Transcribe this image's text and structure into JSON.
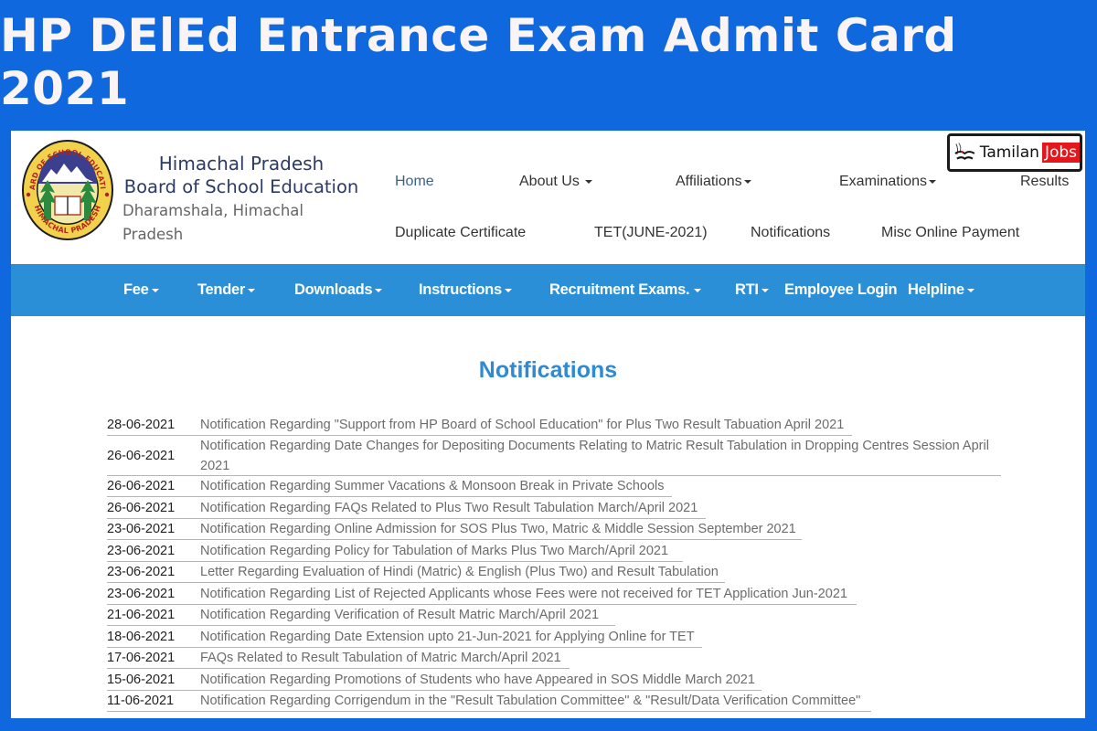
{
  "banner": {
    "title": "HP DElEd Entrance Exam Admit Card 2021"
  },
  "header": {
    "logo": {
      "ring_top": "BOARD OF SCHOOL EDUCATION",
      "ring_bottom": "HIMACHAL PRADESH"
    },
    "org_name_line1": "Himachal Pradesh",
    "org_name_line2": "Board of School Education",
    "org_location": "Dharamshala, Himachal Pradesh"
  },
  "watermark": {
    "text": "Tamilan",
    "highlight": "Jobs"
  },
  "top_nav": [
    {
      "label": "Home",
      "dropdown": false,
      "active": true
    },
    {
      "label": "About Us",
      "dropdown": true
    },
    {
      "label": "Affiliations",
      "dropdown": true
    },
    {
      "label": "Examinations",
      "dropdown": true
    },
    {
      "label": "Results",
      "dropdown": false
    },
    {
      "label": "Duplicate Certificate",
      "dropdown": false
    },
    {
      "label": "TET(JUNE-2021)",
      "dropdown": false
    },
    {
      "label": "Notifications",
      "dropdown": false
    },
    {
      "label": "Misc Online Payment",
      "dropdown": false
    }
  ],
  "main_nav": [
    {
      "label": "Fee",
      "dropdown": true
    },
    {
      "label": "Tender",
      "dropdown": true
    },
    {
      "label": "Downloads",
      "dropdown": true
    },
    {
      "label": "Instructions",
      "dropdown": true
    },
    {
      "label": "Recruitment Exams.",
      "dropdown": true
    },
    {
      "label": "RTI",
      "dropdown": true
    },
    {
      "label": "Employee Login",
      "dropdown": false
    },
    {
      "label": "Helpline",
      "dropdown": true
    }
  ],
  "notifications": {
    "title": "Notifications",
    "items": [
      {
        "date": "28-06-2021",
        "text": "Notification Regarding \"Support from HP Board of School Education\" for Plus Two Result Tabuation April 2021"
      },
      {
        "date": "26-06-2021",
        "text": "Notification Regarding Date Changes for Depositing Documents Relating to Matric Result Tabulation in Dropping Centres Session April 2021"
      },
      {
        "date": "26-06-2021",
        "text": "Notification Regarding Summer Vacations & Monsoon Break in Private Schools"
      },
      {
        "date": "26-06-2021",
        "text": "Notification Regarding FAQs Related to Plus Two Result Tabulation March/April 2021"
      },
      {
        "date": "23-06-2021",
        "text": "Notification Regarding Online Admission for SOS Plus Two, Matric & Middle Session September 2021"
      },
      {
        "date": "23-06-2021",
        "text": "Notification Regarding Policy for Tabulation of Marks Plus Two March/April 2021"
      },
      {
        "date": "23-06-2021",
        "text": "Letter Regarding Evaluation of Hindi (Matric) & English (Plus Two) and Result Tabulation"
      },
      {
        "date": "23-06-2021",
        "text": "Notification Regarding List of Rejected Applicants whose Fees were not received for TET Application Jun-2021"
      },
      {
        "date": "21-06-2021",
        "text": "Notification Regarding Verification of Result Matric March/April 2021"
      },
      {
        "date": "18-06-2021",
        "text": "Notification Regarding Date Extension upto 21-Jun-2021 for Applying Online for TET"
      },
      {
        "date": "17-06-2021",
        "text": "FAQs Related to Result Tabulation of Matric March/April 2021"
      },
      {
        "date": "15-06-2021",
        "text": "Notification Regarding Promotions of Students who have Appeared in SOS Middle March 2021"
      },
      {
        "date": "11-06-2021",
        "text": "Notification Regarding Corrigendum in the \"Result Tabulation Committee\" & \"Result/Data Verification Committee\""
      }
    ]
  },
  "colors": {
    "banner_bg": "#0f68de",
    "nav_bar": "#2a8fd6",
    "title_blue": "#2d8ad3",
    "org_text": "#2c3a66",
    "watermark_red": "#e4181c"
  }
}
